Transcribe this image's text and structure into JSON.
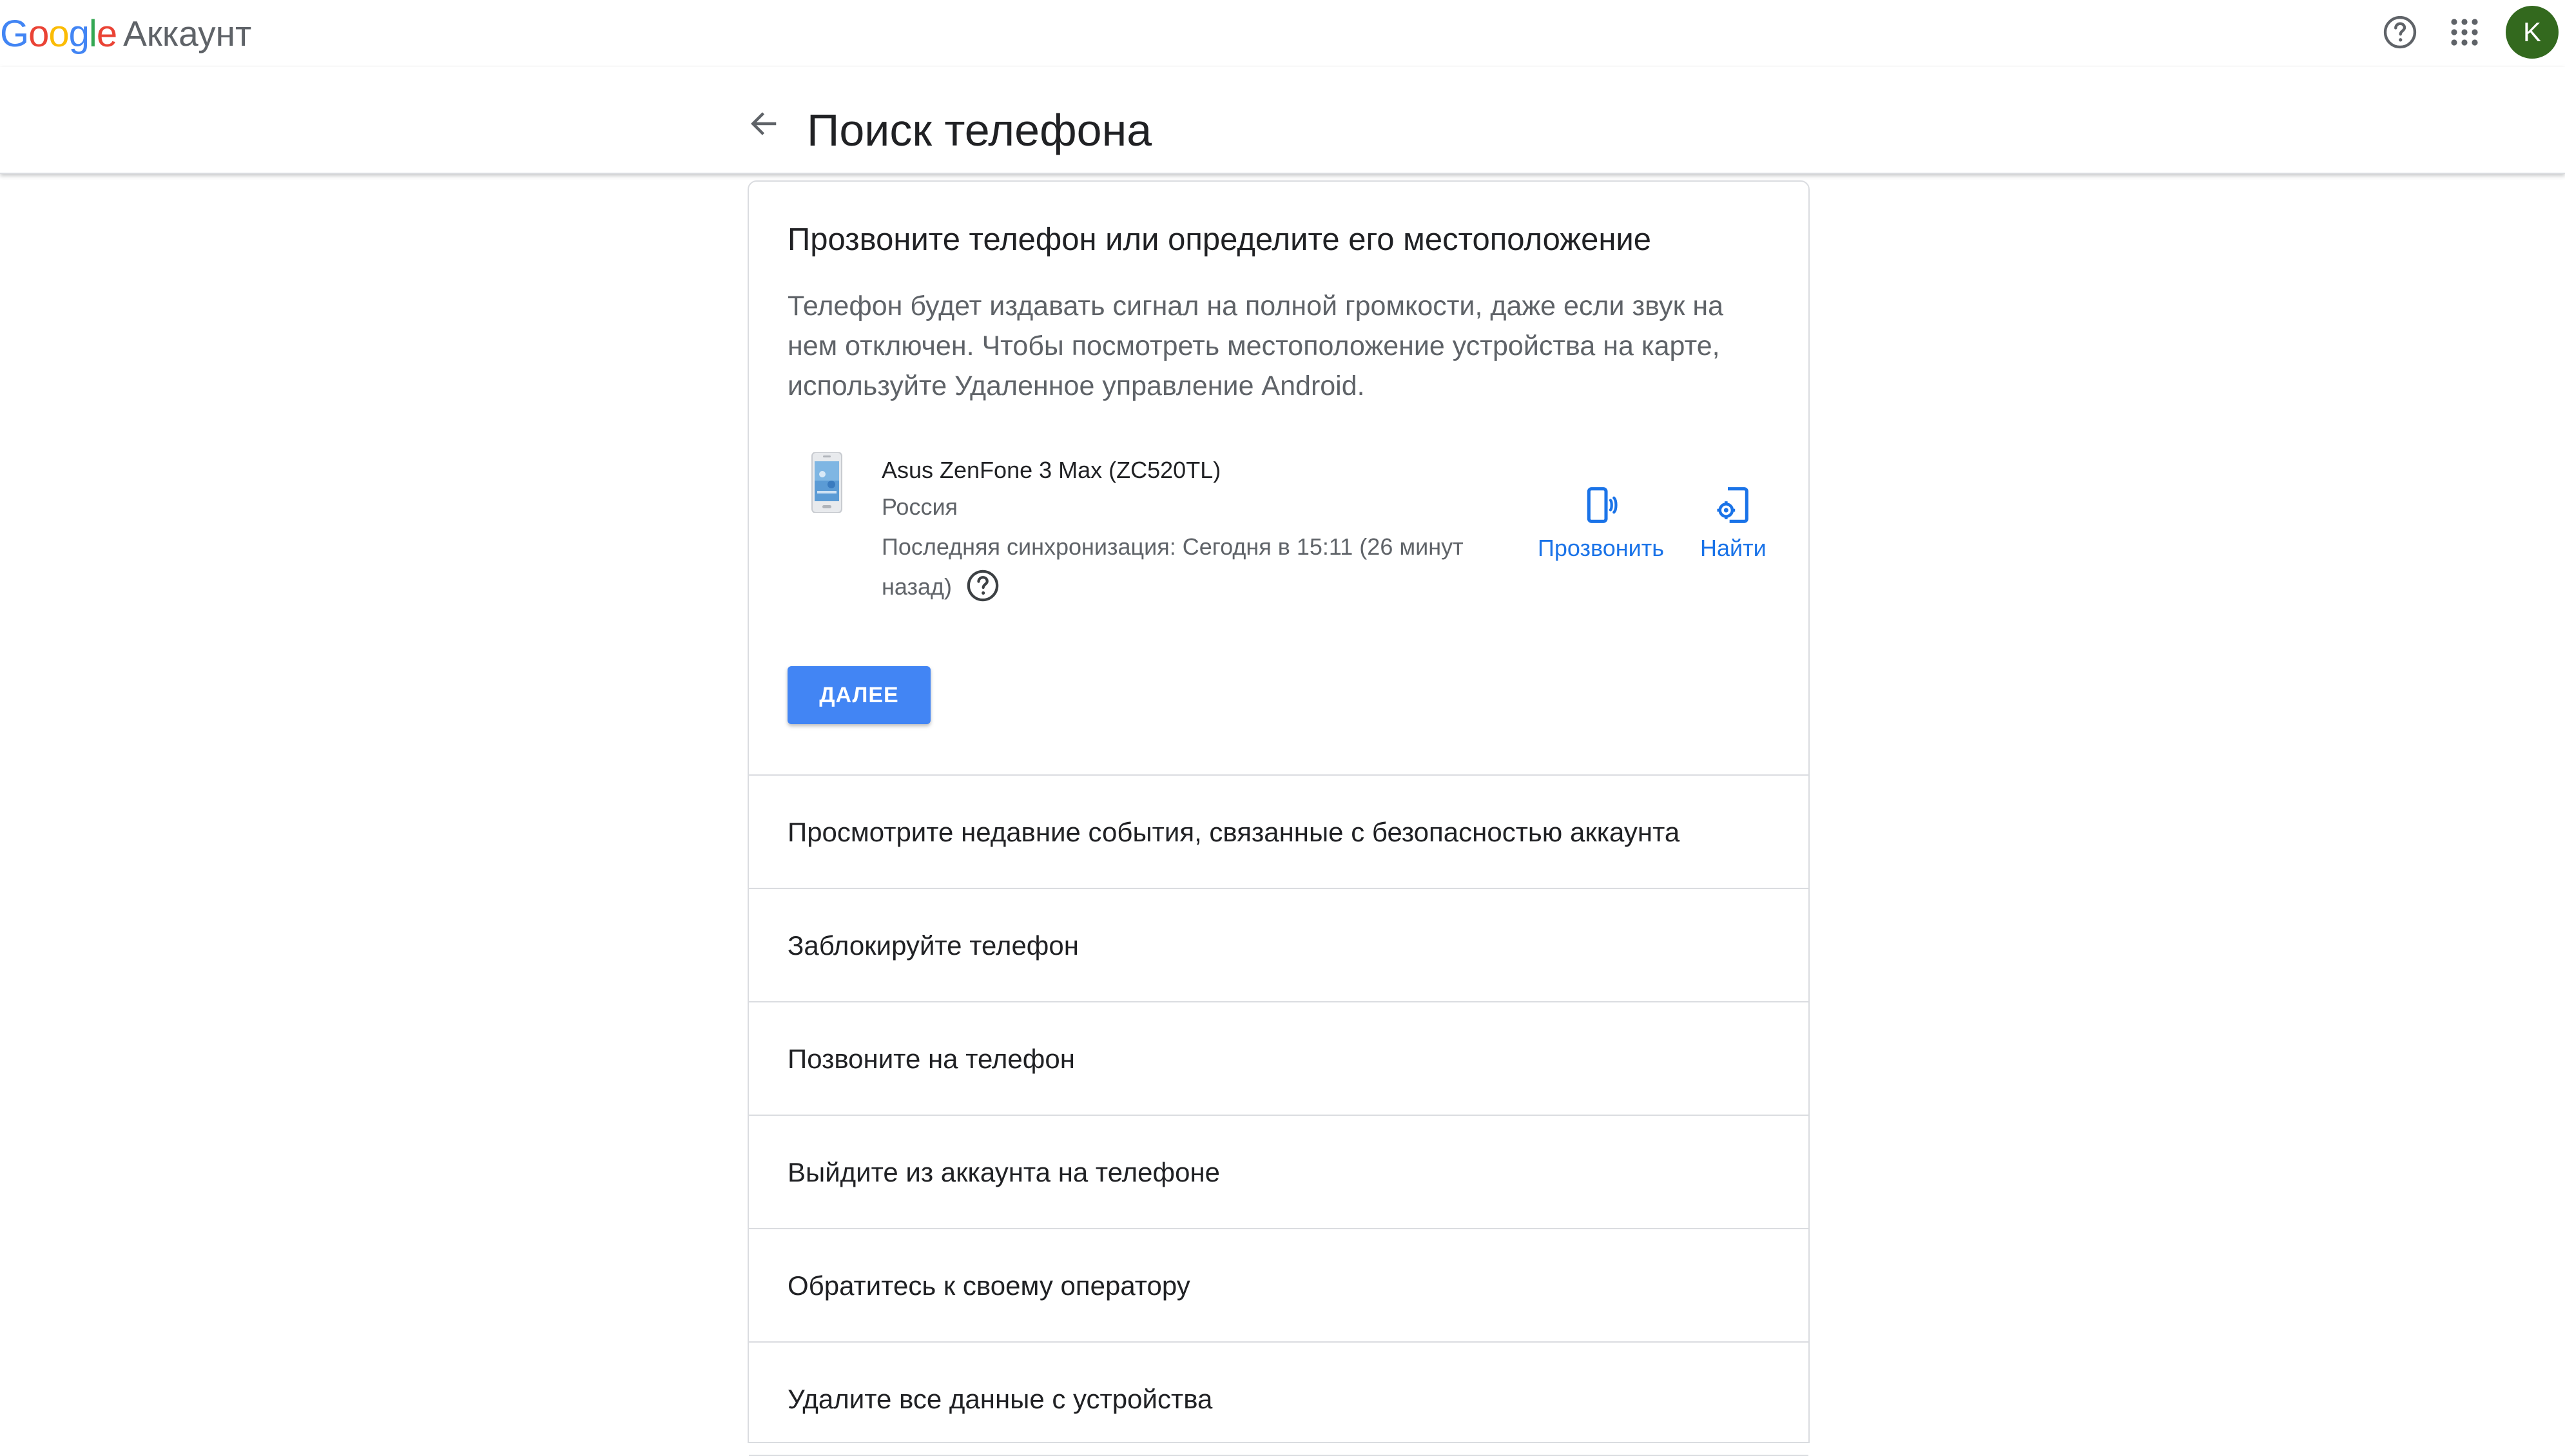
{
  "header": {
    "logo_letters": [
      "G",
      "o",
      "o",
      "g",
      "l",
      "e"
    ],
    "logo_colors": [
      "#4285F4",
      "#EA4335",
      "#FBBC05",
      "#4285F4",
      "#34A853",
      "#EA4335"
    ],
    "product": "Аккаунт",
    "avatar_initial": "K",
    "avatar_color": "#33691E",
    "icons": [
      "help-icon",
      "apps-grid-icon"
    ]
  },
  "page": {
    "title": "Поиск телефона",
    "back_icon": "arrow-left-icon"
  },
  "section": {
    "title": "Прозвоните телефон или определите его местоположение",
    "description": "Телефон будет издавать сигнал на полной громкости, даже если звук на нем отключен. Чтобы посмотреть местоположение устройства на карте, используйте Удаленное управление Android.",
    "device": {
      "name": "Asus ZenFone 3 Max (ZC520TL)",
      "country": "Россия",
      "sync": "Последняя синхронизация: Сегодня в 15:11 (26 минут назад)"
    },
    "actions": {
      "ring_label": "Прозвонить",
      "find_label": "Найти"
    },
    "next_button": "ДАЛЕЕ",
    "accent_color": "#1A73E8",
    "button_color": "#4285F4"
  },
  "list": [
    {
      "label": "Просмотрите недавние события, связанные с безопасностью аккаунта"
    },
    {
      "label": "Заблокируйте телефон"
    },
    {
      "label": "Позвоните на телефон"
    },
    {
      "label": "Выйдите из аккаунта на телефоне"
    },
    {
      "label": "Обратитесь к своему оператору"
    },
    {
      "label": "Удалите все данные с устройства"
    }
  ]
}
